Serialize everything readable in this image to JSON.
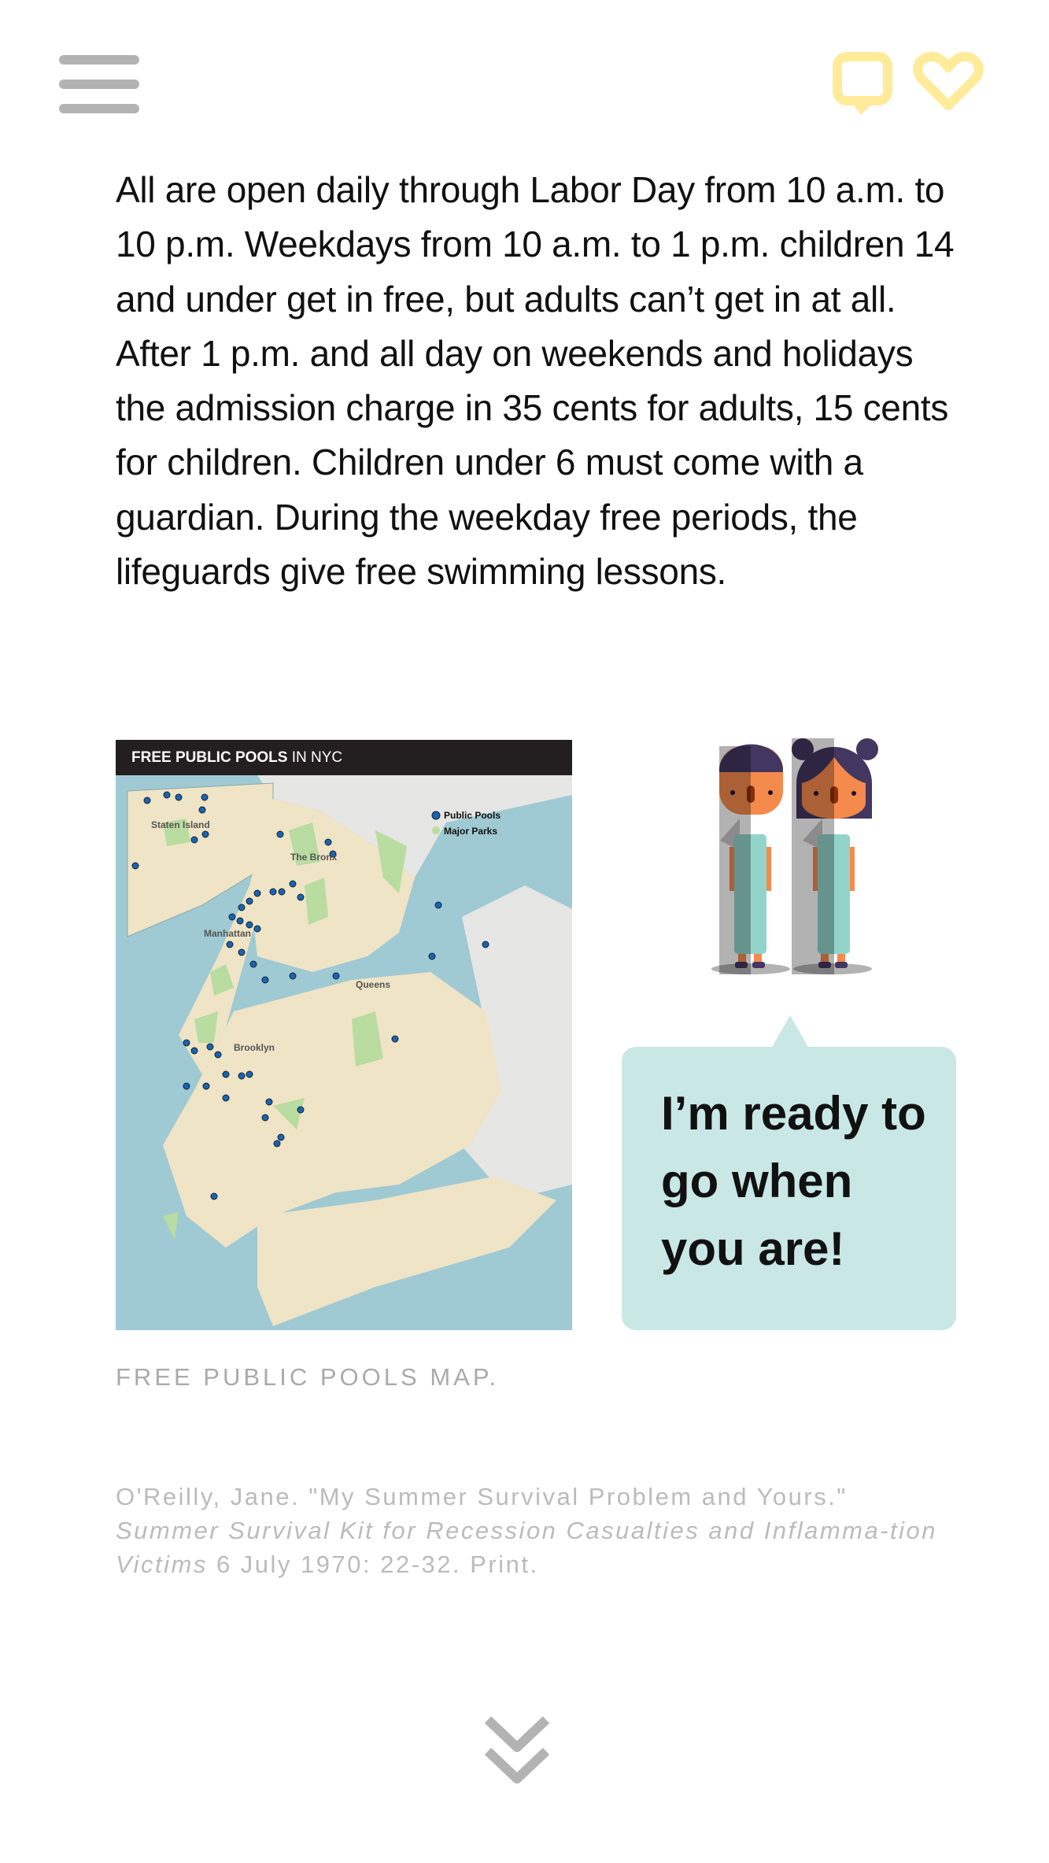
{
  "header": {
    "menu_icon": "hamburger-icon",
    "comment_icon": "comment-icon",
    "favorite_icon": "heart-icon",
    "menu_color": "#b3b3b3",
    "icon_color": "#ffeb99"
  },
  "article": {
    "paragraph": "All are open daily through Labor Day from 10 a.m. to 10 p.m. Weekdays from 10 a.m. to 1 p.m. children 14 and under get in free, but adults can’t get in at all. After 1 p.m. and all day on weekends and holidays the admission charge in 35 cents for adults, 15 cents for children. Children under 6 must come with a guardian. During the weekday free periods, the lifeguards give free swimming lessons."
  },
  "map": {
    "title_bold": "FREE PUBLIC POOLS",
    "title_rest": " IN NYC",
    "legend": [
      "Public Pools",
      "Major Parks"
    ],
    "boroughs": [
      "Staten Island",
      "The Bronx",
      "Manhattan",
      "Queens",
      "Brooklyn"
    ],
    "caption": "FREE PUBLIC POOLS MAP."
  },
  "bubble": {
    "text": "I’m ready to go when you are!",
    "color": "#c9e8e5"
  },
  "citation": {
    "part1": "O'Reilly, Jane. \"My Summer Survival Problem and Yours.\" ",
    "title_italic": "Summer Survival Kit for Recession Casualties and Inflamma-tion Victims",
    "part2": " 6 July 1970: 22-32. Print."
  },
  "footer": {
    "next_icon": "double-chevron-down-icon"
  }
}
